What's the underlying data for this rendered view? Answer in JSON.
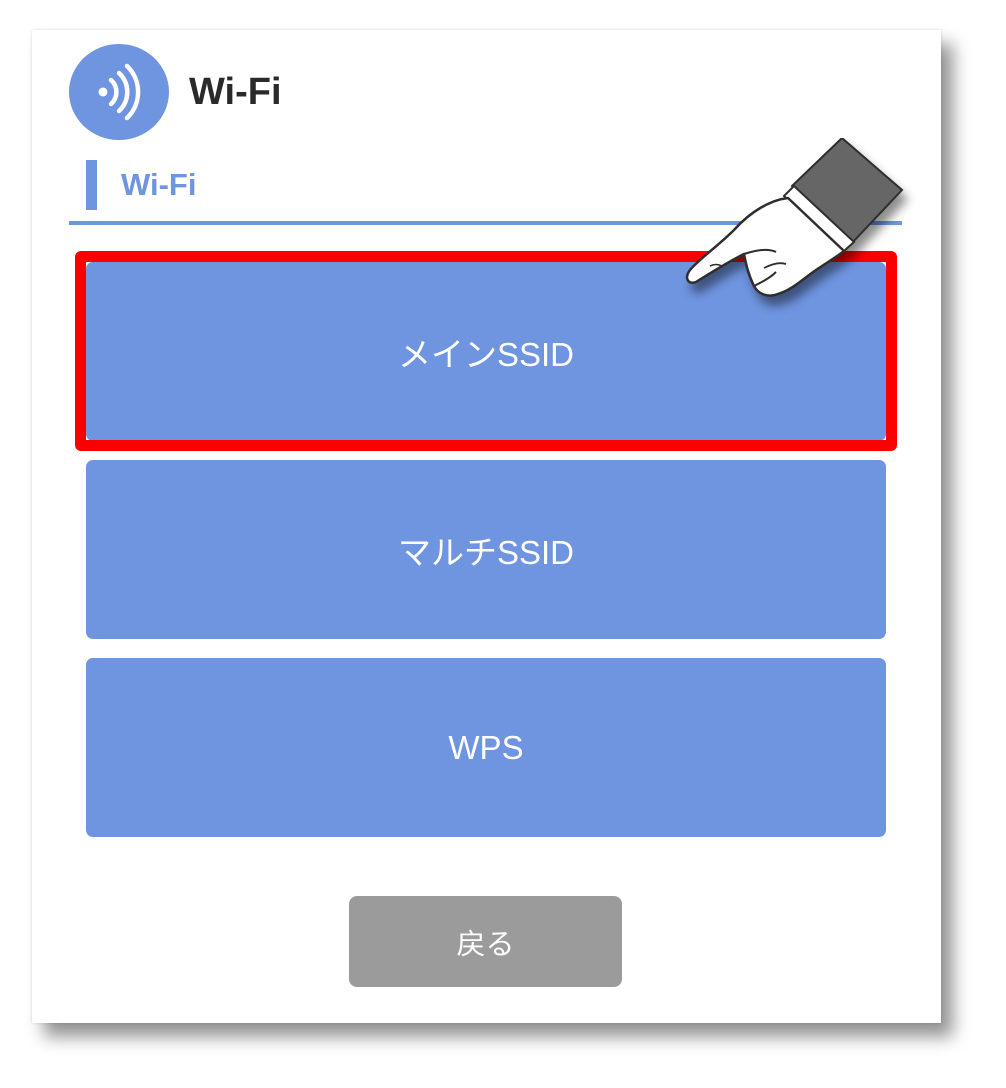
{
  "header": {
    "title": "Wi-Fi",
    "icon": "wifi-signal-icon"
  },
  "section": {
    "title": "Wi-Fi"
  },
  "menu": {
    "items": [
      {
        "label": "メインSSID",
        "highlighted": true
      },
      {
        "label": "マルチSSID",
        "highlighted": false
      },
      {
        "label": "WPS",
        "highlighted": false
      }
    ]
  },
  "footer": {
    "back_label": "戻る"
  },
  "annotations": {
    "pointer_icon": "pointing-hand-icon"
  },
  "colors": {
    "accent": "#6f94e0",
    "highlight": "#fb0000",
    "back_button": "#9b9b9b",
    "title_text": "#2a2a2a"
  }
}
